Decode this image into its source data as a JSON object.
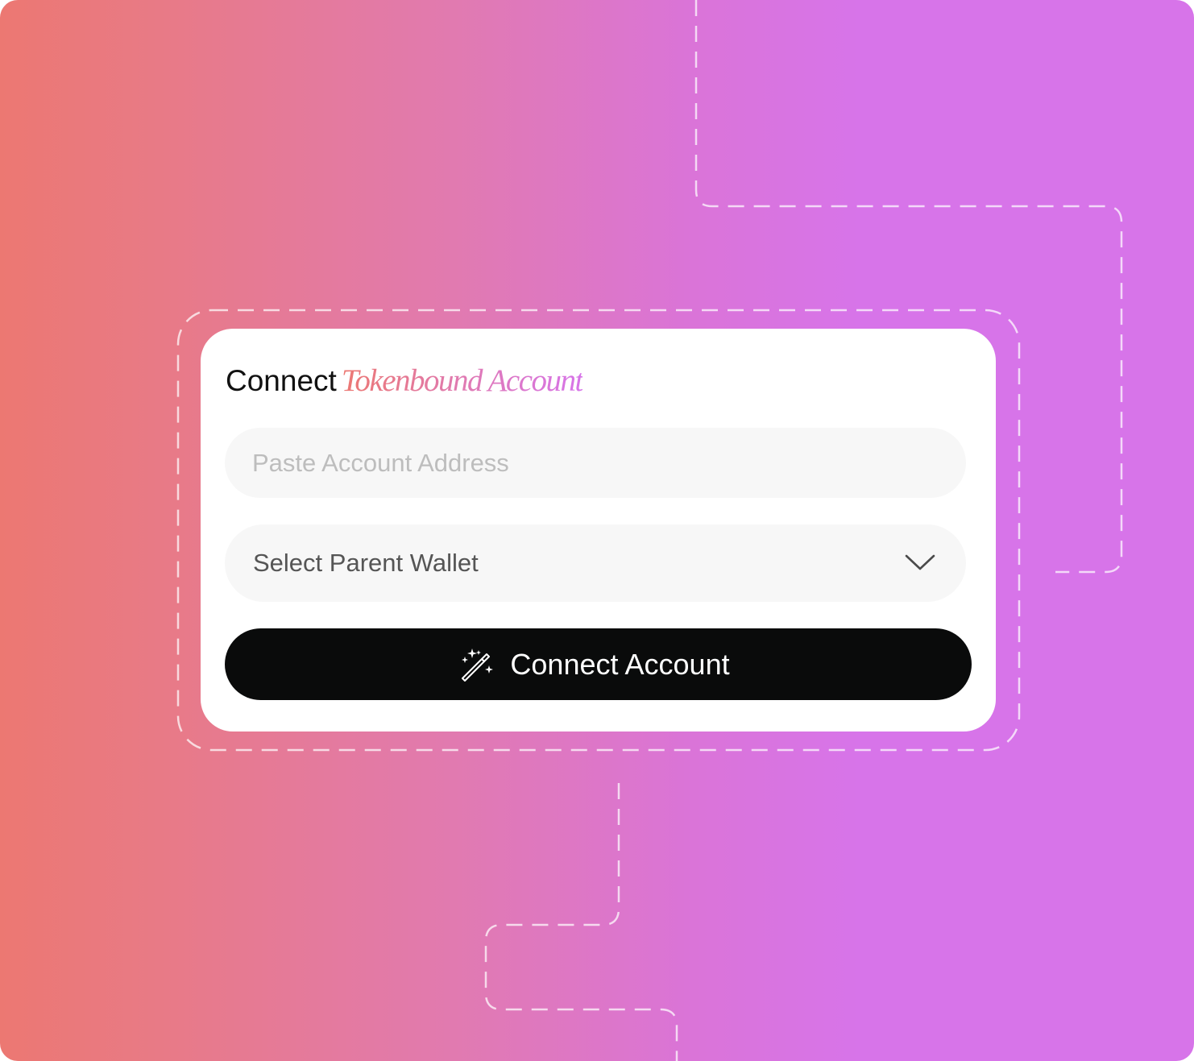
{
  "card": {
    "title_plain": "Connect",
    "title_accent": "Tokenbound Account"
  },
  "address_input": {
    "placeholder": "Paste Account Address",
    "value": ""
  },
  "wallet_select": {
    "label": "Select Parent Wallet",
    "icon": "chevron-down-icon"
  },
  "connect_button": {
    "label": "Connect Account",
    "icon": "magic-wand-icon"
  },
  "colors": {
    "gradient_start": "#ec7872",
    "gradient_end": "#d774e9",
    "button_bg": "#0a0b0b",
    "input_bg": "#f7f7f7"
  }
}
